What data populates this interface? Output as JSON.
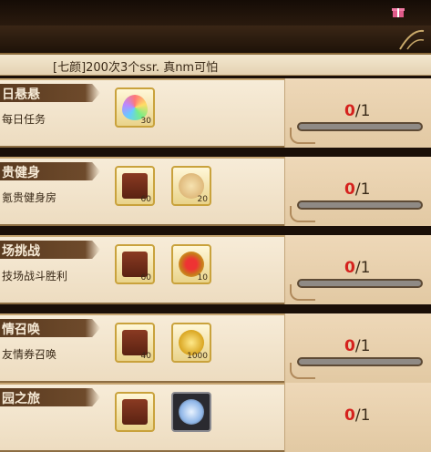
{
  "chat": {
    "text": "[七颜]200次3个ssr. 真nm可怕"
  },
  "tasks": [
    {
      "title": "日悬悬",
      "desc": "每日任务",
      "rewards": [
        {
          "icon": "rainbow-crystal-icon",
          "qty": "30"
        }
      ],
      "done": "0",
      "total": "/1",
      "progress": 0
    },
    {
      "title": "贵健身",
      "desc": "氪贵健身房",
      "rewards": [
        {
          "icon": "exp-book-icon",
          "qty": "60"
        },
        {
          "icon": "bread-icon",
          "qty": "20"
        }
      ],
      "done": "0",
      "total": "/1",
      "progress": 0
    },
    {
      "title": "场挑战",
      "desc": "技场战斗胜利",
      "rewards": [
        {
          "icon": "exp-book-icon",
          "qty": "60"
        },
        {
          "icon": "arena-coin-icon",
          "qty": "10"
        }
      ],
      "done": "0",
      "total": "/1",
      "progress": 0
    },
    {
      "title": "情召唤",
      "desc": "友情券召唤",
      "rewards": [
        {
          "icon": "exp-book-icon",
          "qty": "40"
        },
        {
          "icon": "gold-coin-icon",
          "qty": "1000"
        }
      ],
      "done": "0",
      "total": "/1",
      "progress": 0
    },
    {
      "title": "园之旅",
      "desc": "",
      "rewards": [
        {
          "icon": "exp-book-icon",
          "qty": ""
        },
        {
          "icon": "gem-pile-icon",
          "qty": ""
        }
      ],
      "done": "0",
      "total": "/1",
      "progress": 0
    }
  ]
}
